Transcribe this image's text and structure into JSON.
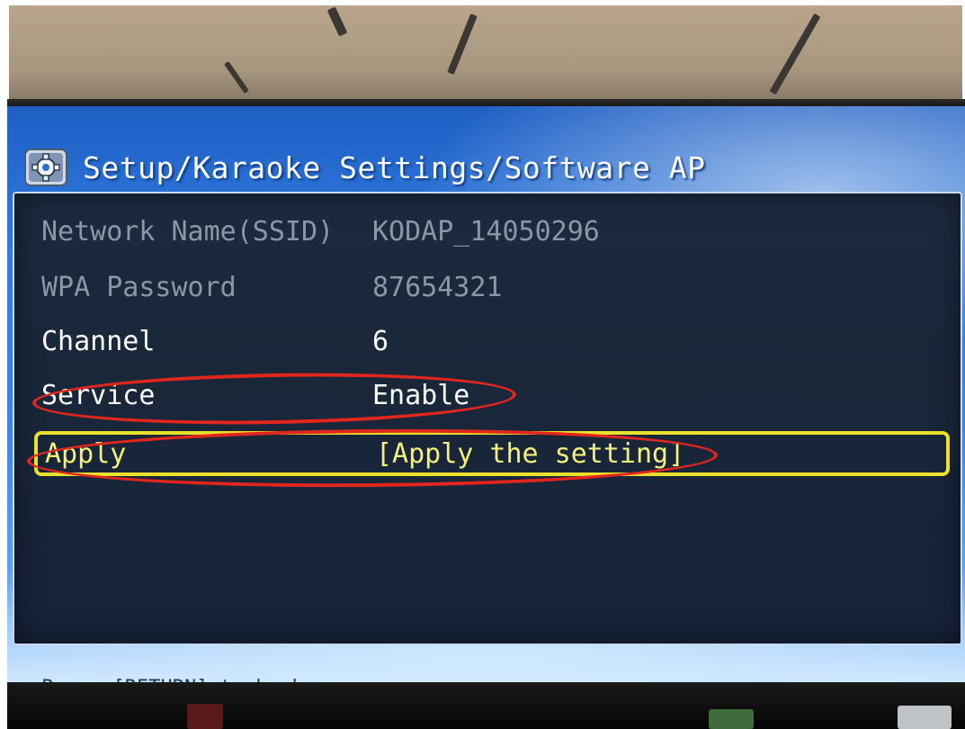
{
  "screen": {
    "title": "Setup/Karaoke Settings/Software AP",
    "icon": "gear-icon",
    "rows": [
      {
        "label": "Network Name(SSID)",
        "value": "KODAP_14050296",
        "state": "disabled"
      },
      {
        "label": "WPA Password",
        "value": "87654321",
        "state": "disabled"
      },
      {
        "label": "Channel",
        "value": "6",
        "state": "normal"
      },
      {
        "label": "Service",
        "value": "Enable",
        "state": "normal"
      },
      {
        "label": "Apply",
        "value": "[Apply the setting]",
        "state": "selected"
      }
    ],
    "footer": "Press [RETURN] to back"
  },
  "colors": {
    "screen_blue": "#2f7be0",
    "panel_dark": "#1a2739",
    "selected_text": "#f4f07a",
    "selected_border": "#e8e12c",
    "annotation_red": "#e0261d",
    "disabled_text": "#8c97a6"
  }
}
